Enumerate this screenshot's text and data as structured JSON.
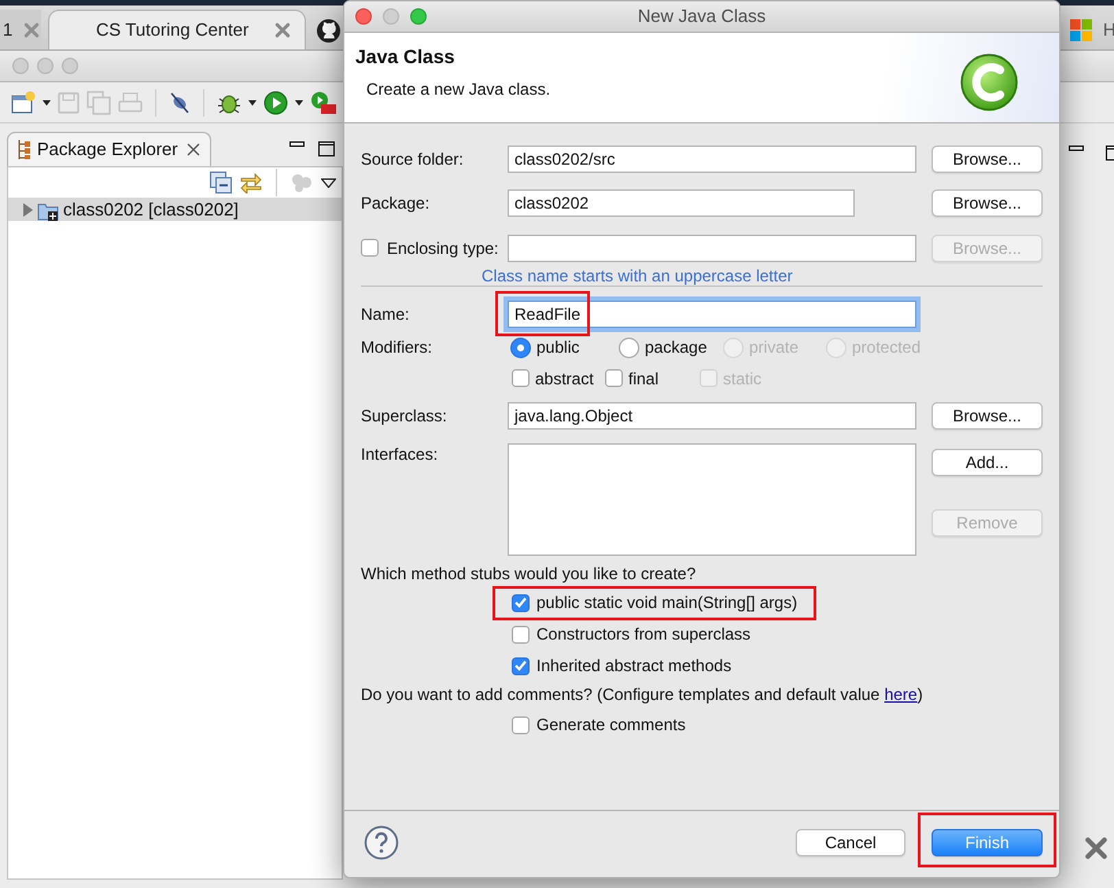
{
  "browser": {
    "tabs": [
      {
        "label": "1",
        "selected": false
      },
      {
        "label": "CS Tutoring Center",
        "selected": true
      }
    ],
    "bookmark_text": "H"
  },
  "ide": {
    "view": {
      "label": "Package Explorer",
      "selected": true
    },
    "tree": [
      {
        "label": "class0202 [class0202]",
        "selected": true,
        "expanded": false
      }
    ]
  },
  "dialog": {
    "title": "New Java Class",
    "header": {
      "title": "Java Class",
      "description": "Create a new Java class."
    },
    "source_folder": {
      "label": "Source folder:",
      "value": "class0202/src",
      "button": {
        "label": "Browse...",
        "disabled": false
      }
    },
    "package": {
      "label": "Package:",
      "value": "class0202",
      "button": {
        "label": "Browse...",
        "disabled": false
      }
    },
    "enclosing_type": {
      "label": "Enclosing type:",
      "checked": false,
      "button": {
        "label": "Browse...",
        "disabled": true
      }
    },
    "hint": "Class name starts with an uppercase letter",
    "name": {
      "label": "Name:",
      "value": "ReadFile",
      "focused": true,
      "highlighted": true
    },
    "modifiers": {
      "label": "Modifiers:",
      "access": [
        {
          "label": "public",
          "selected": true,
          "disabled": false
        },
        {
          "label": "package",
          "selected": false,
          "disabled": false
        },
        {
          "label": "private",
          "selected": false,
          "disabled": true
        },
        {
          "label": "protected",
          "selected": false,
          "disabled": true
        }
      ],
      "flags": [
        {
          "label": "abstract",
          "checked": false,
          "disabled": false
        },
        {
          "label": "final",
          "checked": false,
          "disabled": false
        },
        {
          "label": "static",
          "checked": false,
          "disabled": true
        }
      ]
    },
    "superclass": {
      "label": "Superclass:",
      "value": "java.lang.Object",
      "button": {
        "label": "Browse...",
        "disabled": false
      }
    },
    "interfaces": {
      "label": "Interfaces:",
      "buttons": [
        {
          "label": "Add...",
          "disabled": false
        },
        {
          "label": "Remove",
          "disabled": true
        }
      ]
    },
    "stubs": {
      "question": "Which method stubs would you like to create?",
      "options": [
        {
          "label": "public static void main(String[] args)",
          "checked": true,
          "highlighted": true
        },
        {
          "label": "Constructors from superclass",
          "checked": false,
          "highlighted": false
        },
        {
          "label": "Inherited abstract methods",
          "checked": true,
          "highlighted": false
        }
      ]
    },
    "comments": {
      "text_before": "Do you want to add comments? (Configure templates and default value ",
      "link": "here",
      "text_after": ")",
      "options": [
        {
          "label": "Generate comments",
          "checked": false
        }
      ]
    },
    "buttons": [
      {
        "label": "Cancel",
        "kind": "cancel",
        "highlighted": false
      },
      {
        "label": "Finish",
        "kind": "default",
        "highlighted": true
      }
    ]
  }
}
